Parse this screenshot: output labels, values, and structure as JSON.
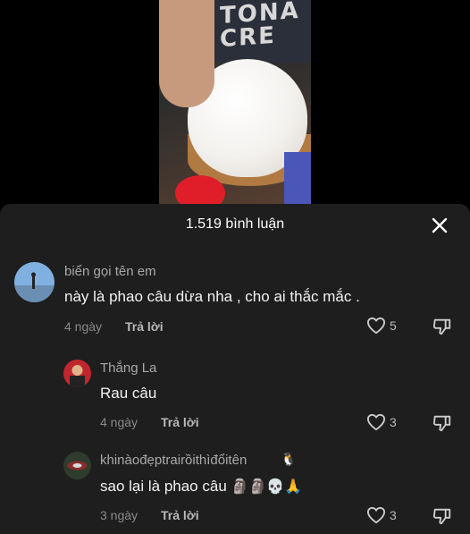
{
  "video": {
    "shirt_text": "TONA\nCRE"
  },
  "header": {
    "title": "1.519 bình luận"
  },
  "comments": [
    {
      "username": "biển gọi tên em",
      "text": "này là phao câu dừa nha , cho ai thắc mắc .",
      "age": "4 ngày",
      "reply_label": "Trả lời",
      "likes": "5"
    },
    {
      "username": "Thắng La",
      "text": "Rau câu",
      "age": "4 ngày",
      "reply_label": "Trả lời",
      "likes": "3"
    },
    {
      "username": "khinàođẹptrairồithìđổitên",
      "text": "sao lại là phao câu",
      "emojis": "🗿🗿💀🙏",
      "age": "3 ngày",
      "reply_label": "Trả lời",
      "likes": "3"
    }
  ],
  "colors": {
    "panel_bg": "#1e1e1e",
    "text_primary": "#f2f2f2",
    "text_secondary": "#8a8a8a"
  }
}
